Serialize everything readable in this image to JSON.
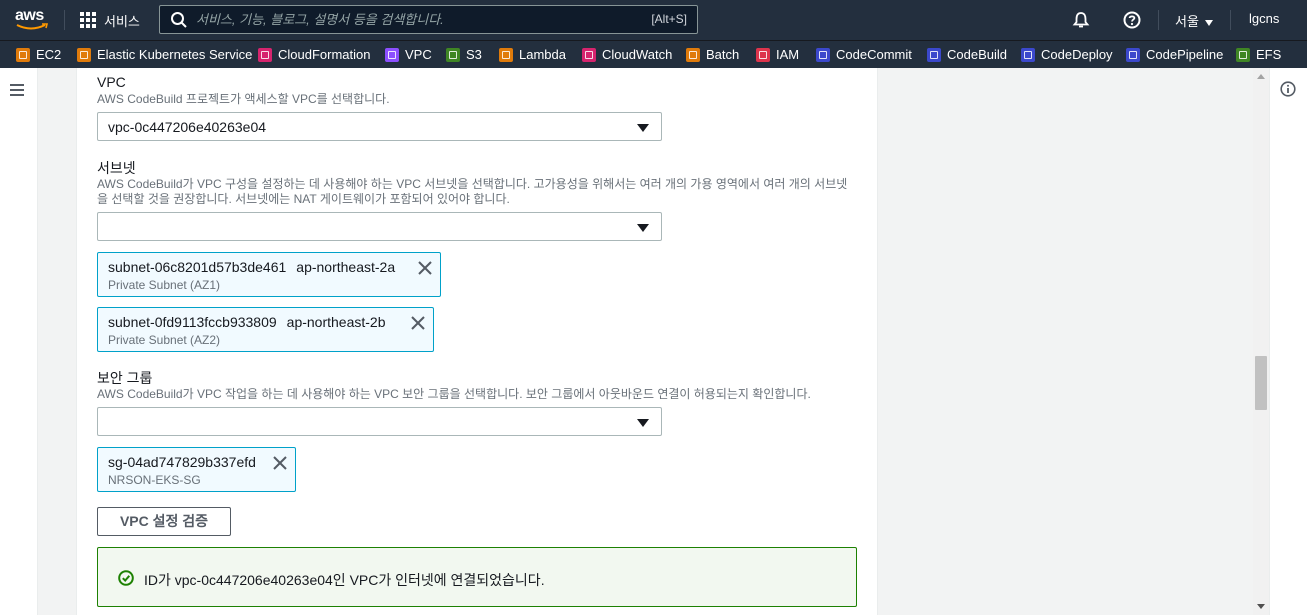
{
  "topnav": {
    "logo_text": "aws",
    "services_label": "서비스",
    "search_placeholder": "서비스, 기능, 블로그, 설명서 등을 검색합니다.",
    "search_shortcut": "[Alt+S]",
    "region_label": "서울",
    "account_label": "lgcns"
  },
  "favorites": [
    {
      "label": "EC2",
      "color": "#e07b0b"
    },
    {
      "label": "Elastic Kubernetes Service",
      "color": "#e07b0b"
    },
    {
      "label": "CloudFormation",
      "color": "#d6246e"
    },
    {
      "label": "VPC",
      "color": "#8c4fff"
    },
    {
      "label": "S3",
      "color": "#3f8624"
    },
    {
      "label": "Lambda",
      "color": "#e07b0b"
    },
    {
      "label": "CloudWatch",
      "color": "#d6246e"
    },
    {
      "label": "Batch",
      "color": "#e07b0b"
    },
    {
      "label": "IAM",
      "color": "#dd344c"
    },
    {
      "label": "CodeCommit",
      "color": "#3b48cc"
    },
    {
      "label": "CodeBuild",
      "color": "#3b48cc"
    },
    {
      "label": "CodeDeploy",
      "color": "#3b48cc"
    },
    {
      "label": "CodePipeline",
      "color": "#3b48cc"
    },
    {
      "label": "EFS",
      "color": "#3f8624"
    }
  ],
  "form": {
    "vpc": {
      "label": "VPC",
      "description": "AWS CodeBuild 프로젝트가 액세스할 VPC를 선택합니다.",
      "selected": "vpc-0c447206e40263e04"
    },
    "subnet": {
      "label": "서브넷",
      "description": "AWS CodeBuild가 VPC 구성을 설정하는 데 사용해야 하는 VPC 서브넷을 선택합니다. 고가용성을 위해서는 여러 개의 가용 영역에서 여러 개의 서브넷을 선택할 것을 권장합니다. 서브넷에는 NAT 게이트웨이가 포함되어 있어야 합니다.",
      "selected": "",
      "tokens": [
        {
          "id": "subnet-06c8201d57b3de461",
          "az": "ap-northeast-2a",
          "name": "Private Subnet (AZ1)"
        },
        {
          "id": "subnet-0fd9113fccb933809",
          "az": "ap-northeast-2b",
          "name": "Private Subnet (AZ2)"
        }
      ]
    },
    "security_group": {
      "label": "보안 그룹",
      "description": "AWS CodeBuild가 VPC 작업을 하는 데 사용해야 하는 VPC 보안 그룹을 선택합니다. 보안 그룹에서 아웃바운드 연결이 허용되는지 확인합니다.",
      "selected": "",
      "tokens": [
        {
          "id": "sg-04ad747829b337efd",
          "name": "NRSON-EKS-SG"
        }
      ]
    },
    "validate_button": "VPC 설정 검증",
    "success_message": "ID가 vpc-0c447206e40263e04인 VPC가 인터넷에 연결되었습니다."
  },
  "colors": {
    "nav_bg": "#232f3e",
    "token_border": "#00a1c9",
    "token_bg": "#f1faff",
    "success": "#1d8102"
  }
}
